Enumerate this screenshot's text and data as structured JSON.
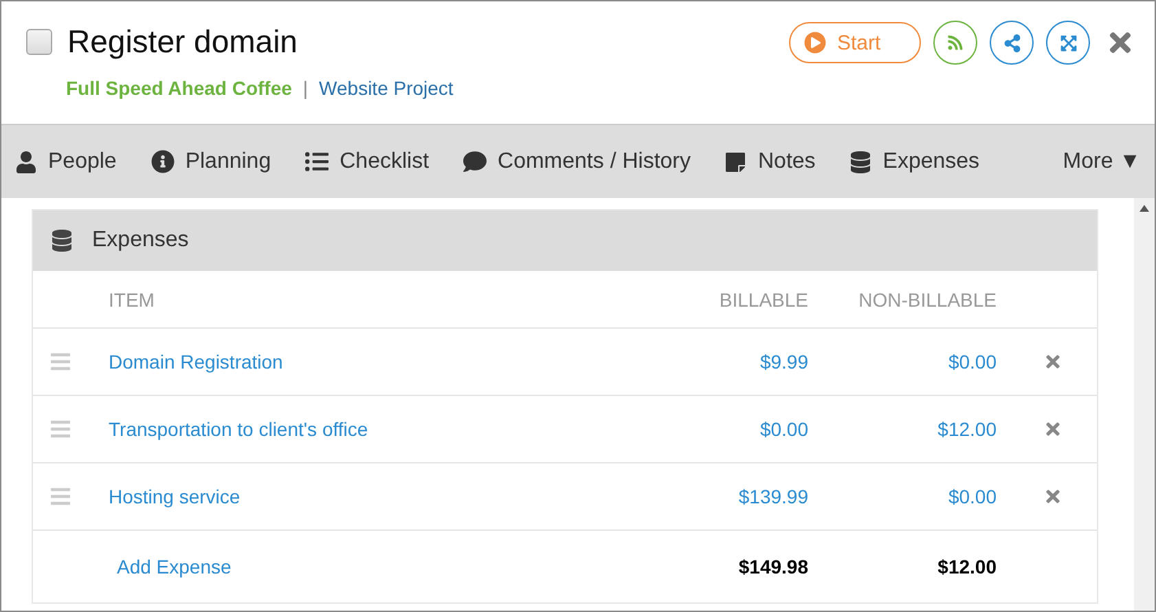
{
  "task": {
    "title": "Register domain",
    "checked": false,
    "client": "Full Speed Ahead Coffee",
    "separator": "|",
    "project": "Website Project"
  },
  "actions": {
    "start": "Start"
  },
  "tabs": [
    {
      "kind": "person",
      "label": "People"
    },
    {
      "kind": "info",
      "label": "Planning"
    },
    {
      "kind": "list",
      "label": "Checklist"
    },
    {
      "kind": "comment",
      "label": "Comments / History"
    },
    {
      "kind": "note",
      "label": "Notes"
    },
    {
      "kind": "database",
      "label": "Expenses"
    },
    {
      "kind": "more",
      "label": "More ▼"
    }
  ],
  "expenses": {
    "title": "Expenses",
    "columns": [
      "ITEM",
      "BILLABLE",
      "NON-BILLABLE"
    ],
    "rows": [
      {
        "item": "Domain Registration",
        "billable": "$9.99",
        "non_billable": "$0.00"
      },
      {
        "item": "Transportation to client's office",
        "billable": "$0.00",
        "non_billable": "$12.00"
      },
      {
        "item": "Hosting service",
        "billable": "$139.99",
        "non_billable": "$0.00"
      }
    ],
    "add": "Add Expense",
    "total_billable": "$149.98",
    "total_non_billable": "$12.00"
  }
}
